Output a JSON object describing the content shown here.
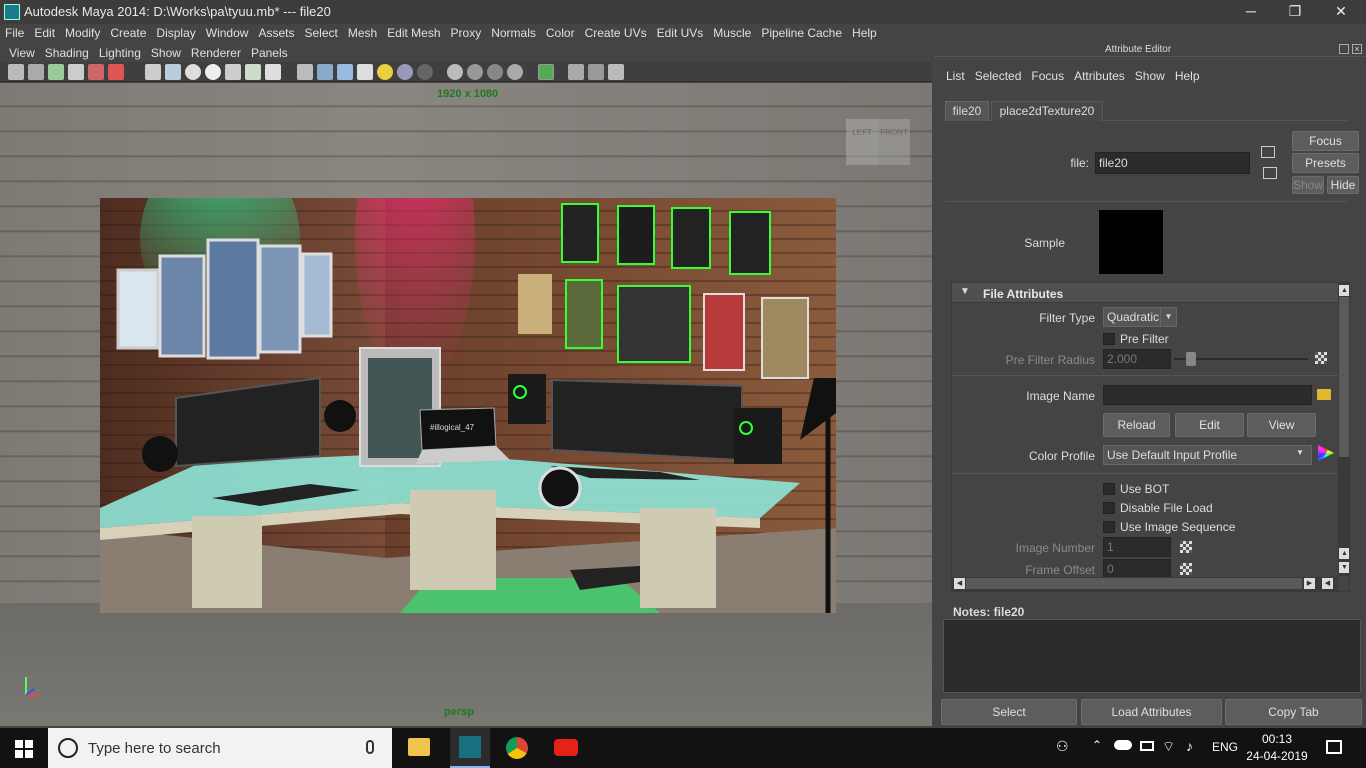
{
  "window": {
    "title": "Autodesk Maya 2014: D:\\Works\\pa\\tyuu.mb*  ---  file20",
    "minimize": "─",
    "maximize": "❐",
    "close": "✕"
  },
  "menubar": [
    "File",
    "Edit",
    "Modify",
    "Create",
    "Display",
    "Window",
    "Assets",
    "Select",
    "Mesh",
    "Edit Mesh",
    "Proxy",
    "Normals",
    "Color",
    "Create UVs",
    "Edit UVs",
    "Muscle",
    "Pipeline Cache",
    "Help"
  ],
  "panel_menu": [
    "View",
    "Shading",
    "Lighting",
    "Show",
    "Renderer",
    "Panels"
  ],
  "viewport": {
    "resolution": "1920 x 1080",
    "camera": "persp",
    "viewcube_left": "LEFT",
    "viewcube_front": "FRONT",
    "laptop_text": "#illogical_47"
  },
  "attribute_editor": {
    "header": "Attribute Editor",
    "menu": [
      "List",
      "Selected",
      "Focus",
      "Attributes",
      "Show",
      "Help"
    ],
    "tabs": [
      "file20",
      "place2dTexture20"
    ],
    "file_label": "file:",
    "file_value": "file20",
    "focus_button": "Focus",
    "presets_button": "Presets",
    "show_button": "Show",
    "hide_button": "Hide",
    "sample_label": "Sample",
    "section_title": "File Attributes",
    "filter_type_label": "Filter Type",
    "filter_type_value": "Quadratic",
    "pre_filter_label": "Pre Filter",
    "pre_filter_radius_label": "Pre Filter Radius",
    "pre_filter_radius_value": "2.000",
    "image_name_label": "Image Name",
    "image_name_value": "",
    "reload_button": "Reload",
    "edit_button": "Edit",
    "view_button": "View",
    "color_profile_label": "Color Profile",
    "color_profile_value": "Use Default Input Profile",
    "use_bot_label": "Use BOT",
    "disable_file_load_label": "Disable File Load",
    "use_image_sequence_label": "Use Image Sequence",
    "image_number_label": "Image Number",
    "image_number_value": "1",
    "frame_offset_label": "Frame Offset",
    "frame_offset_value": "0",
    "notes_label": "Notes:  file20",
    "notes_value": "",
    "select_button": "Select",
    "load_attributes_button": "Load Attributes",
    "copy_tab_button": "Copy Tab"
  },
  "taskbar": {
    "search_placeholder": "Type here to search",
    "language": "ENG",
    "time": "00:13",
    "date": "24-04-2019"
  },
  "colors": {
    "maya_bg": "#444444",
    "field_bg": "#2b2b2b",
    "res_gate_green": "#1f7a1f",
    "youtube_red": "#e62117"
  }
}
